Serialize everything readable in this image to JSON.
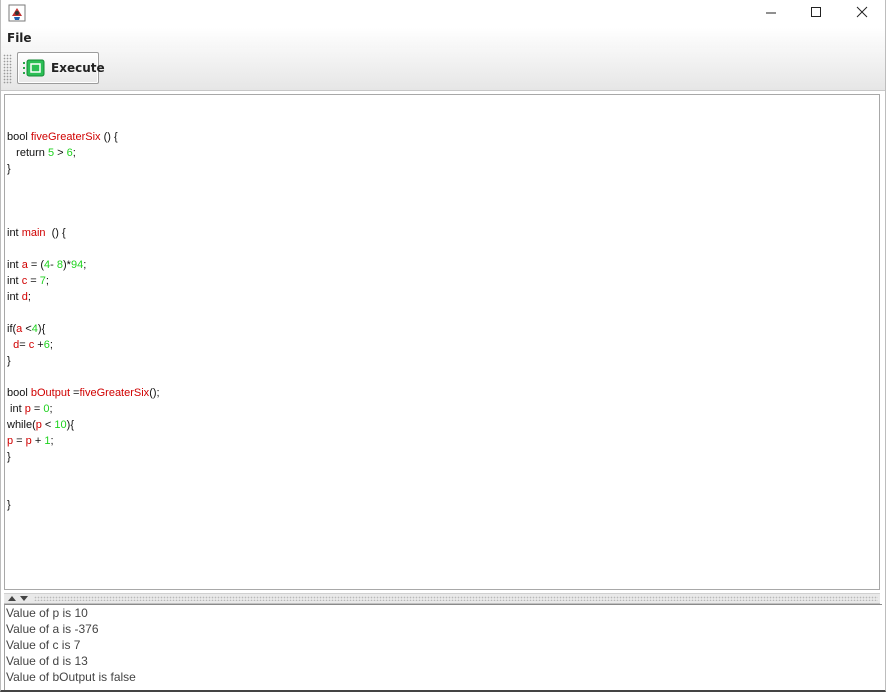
{
  "window": {
    "icon": "java-cup-icon",
    "controls": [
      "minimize-icon",
      "maximize-icon",
      "close-icon"
    ]
  },
  "menu": {
    "file_label": "File"
  },
  "toolbar": {
    "execute_label": "Execute",
    "execute_icon": "execute-icon"
  },
  "editor": {
    "lines": [
      {
        "tokens": []
      },
      {
        "tokens": [
          [
            "k",
            "bool "
          ],
          [
            "id",
            "fiveGreaterSix"
          ],
          [
            "p",
            " () {"
          ]
        ]
      },
      {
        "tokens": [
          [
            "k",
            "   return "
          ],
          [
            "n",
            "5"
          ],
          [
            "p",
            " > "
          ],
          [
            "n",
            "6"
          ],
          [
            "p",
            ";"
          ]
        ]
      },
      {
        "tokens": [
          [
            "p",
            "}"
          ]
        ]
      },
      {
        "tokens": []
      },
      {
        "tokens": []
      },
      {
        "tokens": []
      },
      {
        "tokens": [
          [
            "k",
            "int "
          ],
          [
            "id",
            "main"
          ],
          [
            "p",
            "  () {"
          ]
        ]
      },
      {
        "tokens": []
      },
      {
        "tokens": [
          [
            "k",
            "int "
          ],
          [
            "id",
            "a"
          ],
          [
            "p",
            " = ("
          ],
          [
            "n",
            "4"
          ],
          [
            "p",
            "- "
          ],
          [
            "n",
            "8"
          ],
          [
            "p",
            ")*"
          ],
          [
            "n",
            "94"
          ],
          [
            "p",
            ";"
          ]
        ]
      },
      {
        "tokens": [
          [
            "k",
            "int "
          ],
          [
            "id",
            "c"
          ],
          [
            "p",
            " = "
          ],
          [
            "n",
            "7"
          ],
          [
            "p",
            ";"
          ]
        ]
      },
      {
        "tokens": [
          [
            "k",
            "int "
          ],
          [
            "id",
            "d"
          ],
          [
            "p",
            ";"
          ]
        ]
      },
      {
        "tokens": []
      },
      {
        "tokens": [
          [
            "k",
            "if("
          ],
          [
            "id",
            "a"
          ],
          [
            "p",
            " <"
          ],
          [
            "n",
            "4"
          ],
          [
            "p",
            "){"
          ]
        ]
      },
      {
        "tokens": [
          [
            "p",
            "  "
          ],
          [
            "id",
            "d"
          ],
          [
            "p",
            "= "
          ],
          [
            "id",
            "c"
          ],
          [
            "p",
            " +"
          ],
          [
            "n",
            "6"
          ],
          [
            "p",
            ";"
          ]
        ]
      },
      {
        "tokens": [
          [
            "p",
            "}"
          ]
        ]
      },
      {
        "tokens": []
      },
      {
        "tokens": [
          [
            "k",
            "bool "
          ],
          [
            "id",
            "bOutput"
          ],
          [
            "p",
            " ="
          ],
          [
            "id",
            "fiveGreaterSix"
          ],
          [
            "p",
            "();"
          ]
        ]
      },
      {
        "tokens": [
          [
            "k",
            " int "
          ],
          [
            "id",
            "p"
          ],
          [
            "p",
            " = "
          ],
          [
            "n",
            "0"
          ],
          [
            "p",
            ";"
          ]
        ]
      },
      {
        "tokens": [
          [
            "k",
            "while("
          ],
          [
            "id",
            "p"
          ],
          [
            "p",
            " < "
          ],
          [
            "n",
            "10"
          ],
          [
            "p",
            "){"
          ]
        ]
      },
      {
        "tokens": [
          [
            "id",
            "p"
          ],
          [
            "p",
            " = "
          ],
          [
            "id",
            "p"
          ],
          [
            "p",
            " + "
          ],
          [
            "n",
            "1"
          ],
          [
            "p",
            ";"
          ]
        ]
      },
      {
        "tokens": [
          [
            "p",
            "}"
          ]
        ]
      },
      {
        "tokens": []
      },
      {
        "tokens": []
      },
      {
        "tokens": [
          [
            "p",
            "}"
          ]
        ]
      }
    ]
  },
  "console": {
    "lines": [
      "Value of p is 10",
      "Value of a is -376",
      "Value of c is 7",
      "Value of d is 13",
      "Value of bOutput is false"
    ]
  },
  "colors": {
    "keyword": "#111111",
    "identifier": "#d00000",
    "number": "#1ed21e"
  }
}
